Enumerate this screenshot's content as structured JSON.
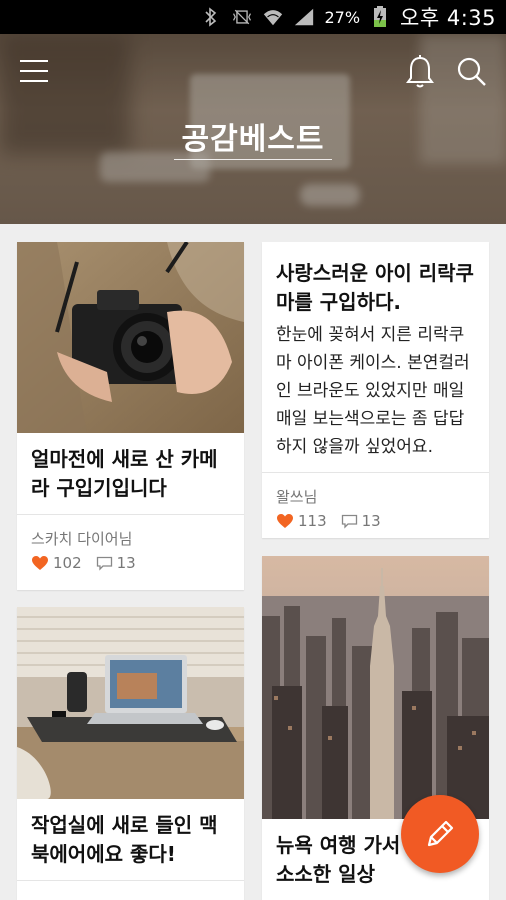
{
  "status_bar": {
    "battery_percent": "27%",
    "time": "오후 4:35",
    "icons": [
      "bluetooth-icon",
      "vibrate-icon",
      "wifi-icon",
      "signal-icon",
      "battery-charging-icon"
    ]
  },
  "header": {
    "title": "공감베스트",
    "icons": {
      "menu": "menu-icon",
      "notifications": "bell-icon",
      "search": "search-icon"
    }
  },
  "cards": [
    {
      "title": "얼마전에 새로 산 카메라 구입기입니다",
      "author": "스카치 다이어님",
      "likes": "102",
      "comments": "13",
      "image": "camera-photo"
    },
    {
      "title": "사랑스러운 아이 리락쿠마를 구입하다.",
      "body": "한눈에 꽂혀서 지른 리락쿠마 아이폰 케이스. 본연컬러인 브라운도 있었지만 매일매일 보는색으로는 좀 답답하지 않을까 싶었어요.",
      "author": "왈쓰님",
      "likes": "113",
      "comments": "13"
    },
    {
      "title": "작업실에 새로 들인 맥북에어에요 좋다!",
      "author": "",
      "image": "laptop-desk-photo"
    },
    {
      "title": "뉴욕 여행 가서 본 작고 소소한 일상",
      "image": "city-skyline-photo"
    }
  ],
  "colors": {
    "accent": "#f15a24",
    "heart": "#f26522",
    "background": "#eeeeee"
  },
  "fab": {
    "icon": "pencil-icon"
  }
}
